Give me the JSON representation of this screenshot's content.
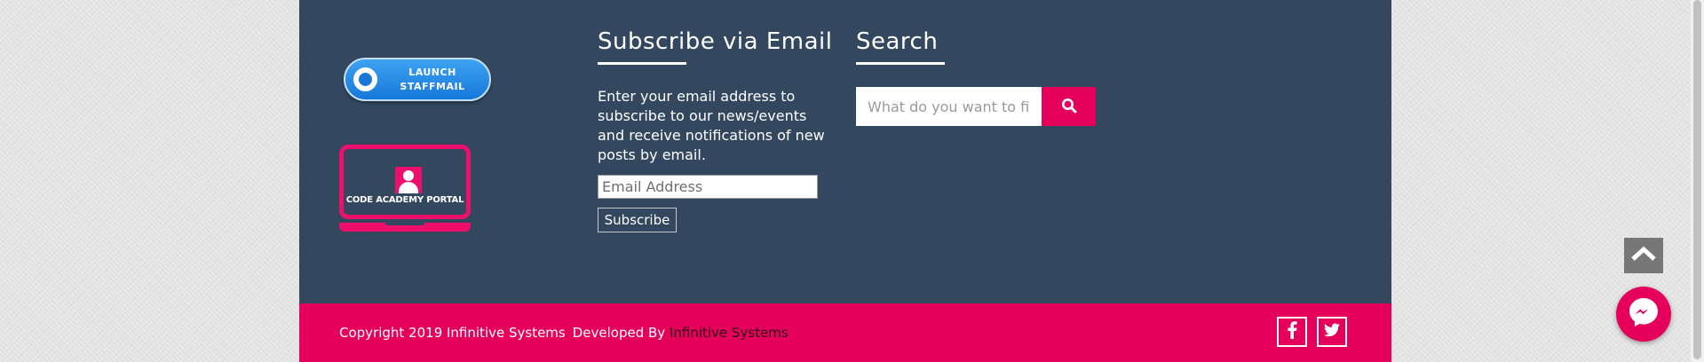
{
  "staffmail": {
    "line1": "LAUNCH",
    "line2": "STAFFMAIL"
  },
  "code_academy": {
    "label": "CODE ACADEMY PORTAL"
  },
  "subscribe": {
    "title": "Subscribe via Email",
    "description": "Enter your email address to subscribe to our news/events and receive notifications of new posts by email.",
    "email_placeholder": "Email Address",
    "button_label": "Subscribe"
  },
  "search": {
    "title": "Search",
    "placeholder": "What do you want to find?",
    "button_icon": "search-icon"
  },
  "footer": {
    "copyright": "Copyright 2019 Infinitive Systems",
    "developed_by": "Developed By",
    "developer": "Infinitive Systems",
    "social": [
      {
        "icon": "facebook-icon"
      },
      {
        "icon": "twitter-icon"
      }
    ]
  },
  "widgets": {
    "scroll_top_icon": "chevron-up-icon",
    "messenger_icon": "messenger-icon"
  },
  "colors": {
    "footer_background": "#33475e",
    "accent": "#e5005b",
    "staffmail_blue": "#1e88e5"
  }
}
